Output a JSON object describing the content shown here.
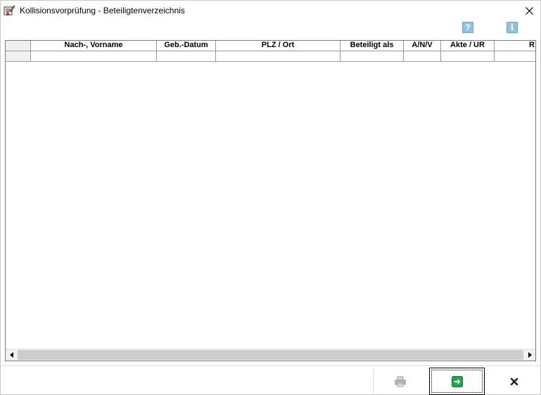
{
  "window": {
    "title": "Kollisionsvorprüfung - Beteiligtenverzeichnis",
    "close_glyph": "✕"
  },
  "toolbar": {
    "help_label": "?",
    "info_label": "i"
  },
  "grid": {
    "columns": [
      {
        "key": "name",
        "label": "Nach-, Vorname"
      },
      {
        "key": "birthdate",
        "label": "Geb.-Datum"
      },
      {
        "key": "location",
        "label": "PLZ / Ort"
      },
      {
        "key": "role",
        "label": "Beteiligt als"
      },
      {
        "key": "anv",
        "label": "A/N/V"
      },
      {
        "key": "file",
        "label": "Akte / UR"
      },
      {
        "key": "more",
        "label": "R"
      }
    ],
    "rows": [
      {
        "name": "",
        "birthdate": "",
        "location": "",
        "role": "",
        "anv": "",
        "file": "",
        "more": ""
      }
    ]
  },
  "footer": {
    "print_icon": "printer-icon",
    "ok_icon": "green-arrow-icon",
    "cancel_icon": "close-icon"
  }
}
